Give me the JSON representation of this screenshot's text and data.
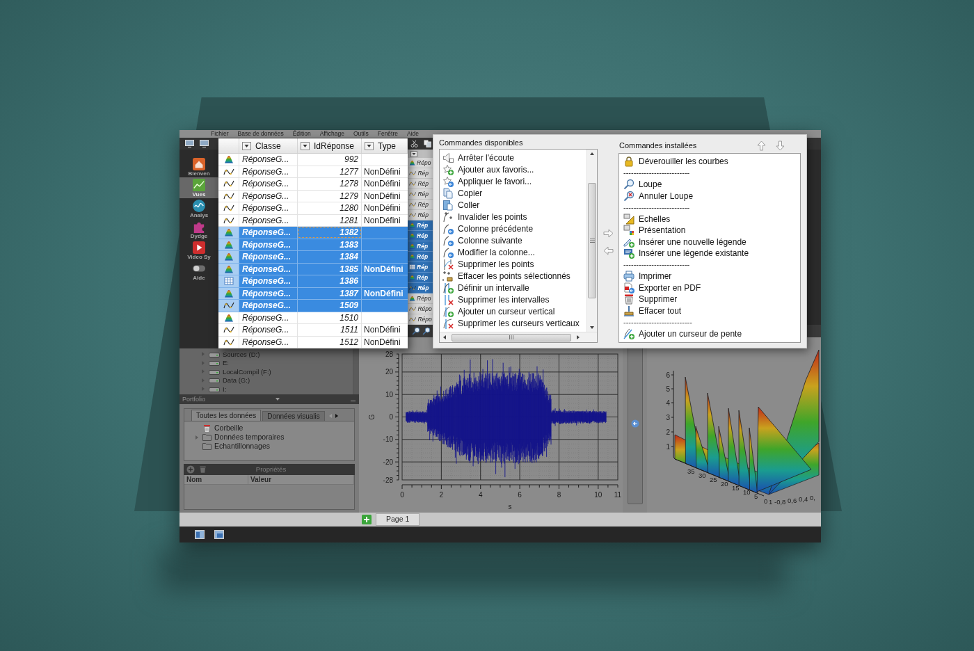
{
  "menu_bar": [
    "Fichier",
    "Base de données",
    "Édition",
    "Affichage",
    "Outils",
    "Fenêtre",
    "Aide"
  ],
  "nav_sidebar": [
    {
      "label": "Bienven",
      "selected": false
    },
    {
      "label": "Vues",
      "selected": true
    },
    {
      "label": "Analys",
      "selected": false
    },
    {
      "label": "Dydge",
      "selected": false
    },
    {
      "label": "Video Sy",
      "selected": false
    },
    {
      "label": "Aide",
      "selected": false
    }
  ],
  "data_table": {
    "columns": [
      "Classe",
      "IdRéponse",
      "Type"
    ],
    "rows": [
      {
        "kind": "surface",
        "classe": "RéponseG...",
        "id": "992",
        "selected": false,
        "focused": false
      },
      {
        "kind": "curve",
        "classe": "RéponseG...",
        "id": "1277",
        "type": "NonDéfini",
        "selected": false,
        "focused": false
      },
      {
        "kind": "curve",
        "classe": "RéponseG...",
        "id": "1278",
        "type": "NonDéfini",
        "selected": false,
        "focused": false
      },
      {
        "kind": "curve",
        "classe": "RéponseG...",
        "id": "1279",
        "type": "NonDéfini",
        "selected": false,
        "focused": false
      },
      {
        "kind": "curve",
        "classe": "RéponseG...",
        "id": "1280",
        "type": "NonDéfini",
        "selected": false,
        "focused": false
      },
      {
        "kind": "curve",
        "classe": "RéponseG...",
        "id": "1281",
        "type": "NonDéfini",
        "selected": false,
        "focused": false
      },
      {
        "kind": "surface",
        "classe": "RéponseG...",
        "id": "1382",
        "selected": true,
        "focused": true
      },
      {
        "kind": "surface",
        "classe": "RéponseG...",
        "id": "1383",
        "selected": true,
        "focused": false
      },
      {
        "kind": "surface",
        "classe": "RéponseG...",
        "id": "1384",
        "selected": true,
        "focused": false
      },
      {
        "kind": "surface",
        "classe": "RéponseG...",
        "id": "1385",
        "type": "NonDéfini",
        "selected": true,
        "focused": false
      },
      {
        "kind": "grid",
        "classe": "RéponseG...",
        "id": "1386",
        "selected": true,
        "focused": false
      },
      {
        "kind": "surface",
        "classe": "RéponseG...",
        "id": "1387",
        "type": "NonDéfini",
        "selected": true,
        "focused": false
      },
      {
        "kind": "curve",
        "classe": "RéponseG...",
        "id": "1509",
        "selected": true,
        "focused": false
      },
      {
        "kind": "surface",
        "classe": "RéponseG...",
        "id": "1510",
        "selected": false,
        "focused": false
      },
      {
        "kind": "curve",
        "classe": "RéponseG...",
        "id": "1511",
        "type": "NonDéfini",
        "selected": false,
        "focused": false
      },
      {
        "kind": "curve",
        "classe": "RéponseG...",
        "id": "1512",
        "type": "NonDéfini",
        "selected": false,
        "focused": false
      }
    ]
  },
  "background_table": {
    "rows": [
      {
        "kind": "surface",
        "label": "Répo",
        "selected": false
      },
      {
        "kind": "curve",
        "label": "Rép",
        "selected": false
      },
      {
        "kind": "curve",
        "label": "Rép",
        "selected": false
      },
      {
        "kind": "curve",
        "label": "Rép",
        "selected": false
      },
      {
        "kind": "curve",
        "label": "Rép",
        "selected": false
      },
      {
        "kind": "curve",
        "label": "Rép",
        "selected": false
      },
      {
        "kind": "surface",
        "label": "Rép",
        "selected": true
      },
      {
        "kind": "surface",
        "label": "Rép",
        "selected": true
      },
      {
        "kind": "surface",
        "label": "Rép",
        "selected": true
      },
      {
        "kind": "surface",
        "label": "Rép",
        "selected": true
      },
      {
        "kind": "grid",
        "label": "Rép",
        "selected": true
      },
      {
        "kind": "surface",
        "label": "Rép",
        "selected": true
      },
      {
        "kind": "curve",
        "label": "Rép",
        "selected": true
      },
      {
        "kind": "surface",
        "label": "Répo",
        "selected": false
      },
      {
        "kind": "curve",
        "label": "Répo",
        "selected": false
      },
      {
        "kind": "curve",
        "label": "Répo",
        "selected": false
      }
    ]
  },
  "drive_tree": [
    "Sources (D:)",
    "E:",
    "LocalCompil (F:)",
    "Data (G:)",
    "I:"
  ],
  "portfolio": {
    "title": "Portfolio",
    "tabs": [
      {
        "label": "Toutes les données",
        "selected": true
      },
      {
        "label": "Données visualis",
        "selected": false
      }
    ],
    "tree": [
      {
        "kind": "trash",
        "label": "Corbeille",
        "expandable": false
      },
      {
        "kind": "folder",
        "label": "Données temporaires",
        "expandable": true
      },
      {
        "kind": "folder",
        "label": "Echantillonnages",
        "expandable": false
      }
    ]
  },
  "properties": {
    "title": "Propriétés",
    "columns": [
      "Nom",
      "Valeur"
    ]
  },
  "waveform_plot": {
    "ylabel": "G",
    "xlabel": "s",
    "yticks": [
      "28",
      "20",
      "10",
      "0",
      "-10",
      "-20",
      "-28"
    ],
    "xticks": [
      "0",
      "2",
      "4",
      "6",
      "8",
      "10",
      "11"
    ]
  },
  "surface_plot": {
    "zticks": [
      "6",
      "5",
      "4",
      "3",
      "2",
      "1"
    ],
    "depth_ticks": [
      "35",
      "30",
      "25",
      "20",
      "15",
      "10",
      "5",
      "0"
    ],
    "xticks": [
      "1",
      "-0,8",
      "0,6",
      "0,4",
      "0,"
    ]
  },
  "page_tabs": [
    {
      "label": "Page 1",
      "selected": true
    }
  ],
  "commands_dialog": {
    "available": {
      "title": "Commandes disponibles",
      "items": [
        "Arrêter l'écoute",
        "Ajouter aux favoris...",
        "Appliquer le favori...",
        "Copier",
        "Coller",
        "Invalider les points",
        "Colonne précédente",
        "Colonne suivante",
        "Modifier la colonne...",
        "Supprimer les points",
        "Effacer les points sélectionnés",
        "Définir un intervalle",
        "Supprimer les intervalles",
        "Ajouter un curseur vertical",
        "Supprimer les curseurs verticaux"
      ]
    },
    "installed": {
      "title": "Commandes installées",
      "items": [
        {
          "kind": "command",
          "label": "Déverouiller les courbes"
        },
        {
          "kind": "separator",
          "label": "--------------------------"
        },
        {
          "kind": "command",
          "label": "Loupe"
        },
        {
          "kind": "command",
          "label": "Annuler Loupe"
        },
        {
          "kind": "separator",
          "label": "--------------------------"
        },
        {
          "kind": "command",
          "label": "Echelles"
        },
        {
          "kind": "command",
          "label": "Présentation"
        },
        {
          "kind": "command",
          "label": "Insérer une nouvelle légende"
        },
        {
          "kind": "command",
          "label": "Insérer une légende existante"
        },
        {
          "kind": "separator",
          "label": "--------------------------"
        },
        {
          "kind": "command",
          "label": "Imprimer"
        },
        {
          "kind": "command",
          "label": "Exporter en PDF"
        },
        {
          "kind": "command",
          "label": "Supprimer"
        },
        {
          "kind": "command",
          "label": "Effacer tout"
        },
        {
          "kind": "separator",
          "label": "---------------------------"
        },
        {
          "kind": "command",
          "label": "Ajouter un curseur de pente"
        }
      ]
    }
  }
}
